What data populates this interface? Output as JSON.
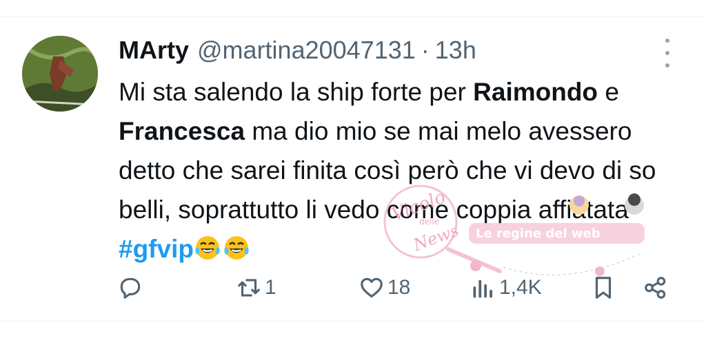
{
  "tweet": {
    "author_name": "MArty",
    "author_handle": "@martina20047131",
    "separator": "·",
    "timestamp": "13h",
    "text": {
      "part1": "Mi sta salendo la ship forte per ",
      "bold1": "Raimondo",
      "part2": " e ",
      "bold2": "Francesca",
      "part3": " ma dio mio se mai melo avessero detto che sarei finita così però che vi devo di so belli, soprattutto li vedo come coppia affiatata ",
      "hashtag": "#gfvip",
      "emoji": "laughing-tears-emoji"
    }
  },
  "actions": {
    "reply_icon": "reply-icon",
    "retweet_count": "1",
    "likes_count": "18",
    "views_count": "1,4K"
  },
  "watermark": {
    "text_lines": [
      "Vicolo",
      "delle",
      "News"
    ],
    "banner_text": "Le regine del web"
  },
  "colors": {
    "hashtag": "#1d9bf0",
    "secondary_text": "#536471",
    "divider": "#eff3f4",
    "watermark_pink": "#f0a9c6"
  }
}
